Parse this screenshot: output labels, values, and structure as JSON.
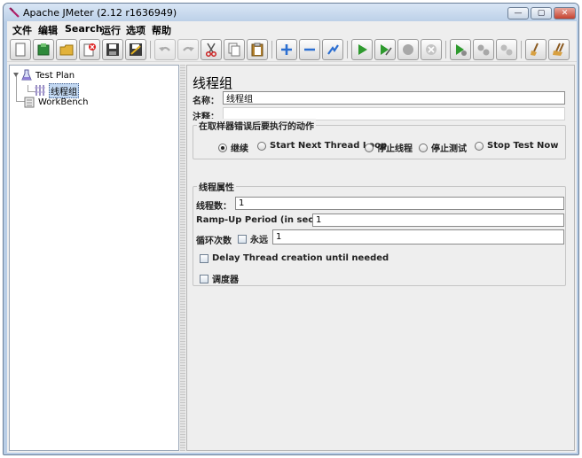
{
  "window": {
    "title": "Apache JMeter (2.12 r1636949)",
    "controls": {
      "minimize": "—",
      "maximize": "▢",
      "close": "✕"
    }
  },
  "menu": [
    "文件",
    "编辑",
    "Search",
    "运行",
    "选项",
    "帮助"
  ],
  "toolbar": [
    {
      "name": "new-icon"
    },
    {
      "name": "templates-icon"
    },
    {
      "name": "open-icon"
    },
    {
      "name": "close-file-icon"
    },
    {
      "name": "save-icon"
    },
    {
      "name": "save-as-icon"
    },
    {
      "name": "undo-icon"
    },
    {
      "name": "redo-icon"
    },
    {
      "name": "cut-icon"
    },
    {
      "name": "copy-icon"
    },
    {
      "name": "paste-icon"
    },
    {
      "name": "expand-icon"
    },
    {
      "name": "collapse-icon"
    },
    {
      "name": "toggle-icon"
    },
    {
      "name": "start-icon"
    },
    {
      "name": "start-no-pause-icon"
    },
    {
      "name": "stop-icon"
    },
    {
      "name": "shutdown-icon"
    },
    {
      "name": "remote-start-icon"
    },
    {
      "name": "remote-stop-icon"
    },
    {
      "name": "remote-shutdown-icon"
    },
    {
      "name": "clear-icon"
    },
    {
      "name": "clear-all-icon"
    }
  ],
  "tree": {
    "test_plan": "Test Plan",
    "thread_group": "线程组",
    "workbench": "WorkBench"
  },
  "panel": {
    "title": "线程组",
    "name_label": "名称：",
    "name_value": "线程组",
    "comment_label": "注释：",
    "comment_value": "",
    "error_action": {
      "title": "在取样器错误后要执行的动作",
      "options": [
        "继续",
        "Start Next Thread Loop",
        "停止线程",
        "停止测试",
        "Stop Test Now"
      ],
      "selected": 0
    },
    "thread_props": {
      "title": "线程属性",
      "threads_label": "线程数：",
      "threads_value": "1",
      "rampup_label": "Ramp-Up Period (in seconds):",
      "rampup_value": "1",
      "loop_label": "循环次数",
      "forever_label": "永远",
      "forever_checked": false,
      "loop_value": "1",
      "delay_label": "Delay Thread creation until needed",
      "delay_checked": false,
      "scheduler_label": "调度器",
      "scheduler_checked": false
    }
  }
}
